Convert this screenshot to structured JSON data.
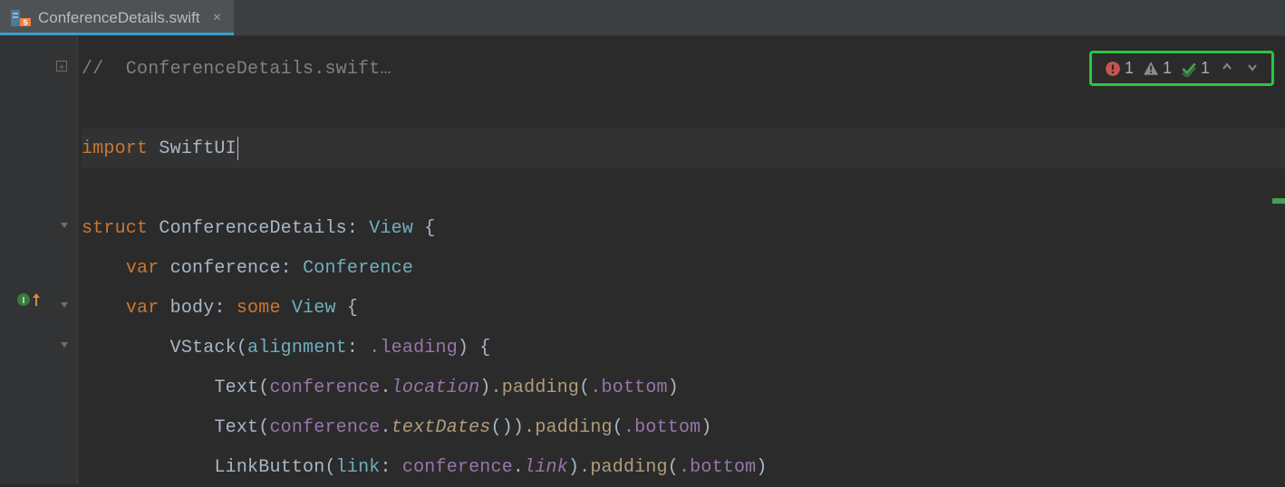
{
  "tab": {
    "filename": "ConferenceDetails.swift",
    "close_glyph": "×"
  },
  "inspections": {
    "error_count": "1",
    "warning_count": "1",
    "typo_count": "1"
  },
  "code": {
    "l1_comment_prefix": "//",
    "l1_comment_text": "  ConferenceDetails.swift…",
    "l3_import": "import",
    "l3_module": "SwiftUI",
    "l5_struct": "struct",
    "l5_name": "ConferenceDetails",
    "l5_colon": ":",
    "l5_proto": "View",
    "l5_brace": " {",
    "l6_var": "var",
    "l6_name": "conference",
    "l6_colon": ":",
    "l6_type": "Conference",
    "l7_var": "var",
    "l7_name": "body",
    "l7_colon": ":",
    "l7_some": "some",
    "l7_type": "View",
    "l7_brace": " {",
    "l8_vstack": "VStack",
    "l8_arglabel": "alignment",
    "l8_argcolon": ":",
    "l8_leading": ".leading",
    "l8_tail": ") {",
    "l9_text": "Text",
    "l9_open": "(",
    "l9_conf": "conference",
    "l9_dot": ".",
    "l9_loc": "location",
    "l9_close": ")",
    "l9_pad": ".padding",
    "l9_popen": "(",
    "l9_bottom": ".bottom",
    "l9_pclose": ")",
    "l10_text": "Text",
    "l10_open": "(",
    "l10_conf": "conference",
    "l10_dot": ".",
    "l10_func": "textDates",
    "l10_call": "())",
    "l10_pad": ".padding",
    "l10_popen": "(",
    "l10_bottom": ".bottom",
    "l10_pclose": ")",
    "l11_lb": "LinkButton",
    "l11_open": "(",
    "l11_label": "link",
    "l11_colon": ":",
    "l11_conf": "conference",
    "l11_dot": ".",
    "l11_link": "link",
    "l11_close": ")",
    "l11_pad": ".padding",
    "l11_popen": "(",
    "l11_bottom": ".bottom",
    "l11_pclose": ")"
  }
}
